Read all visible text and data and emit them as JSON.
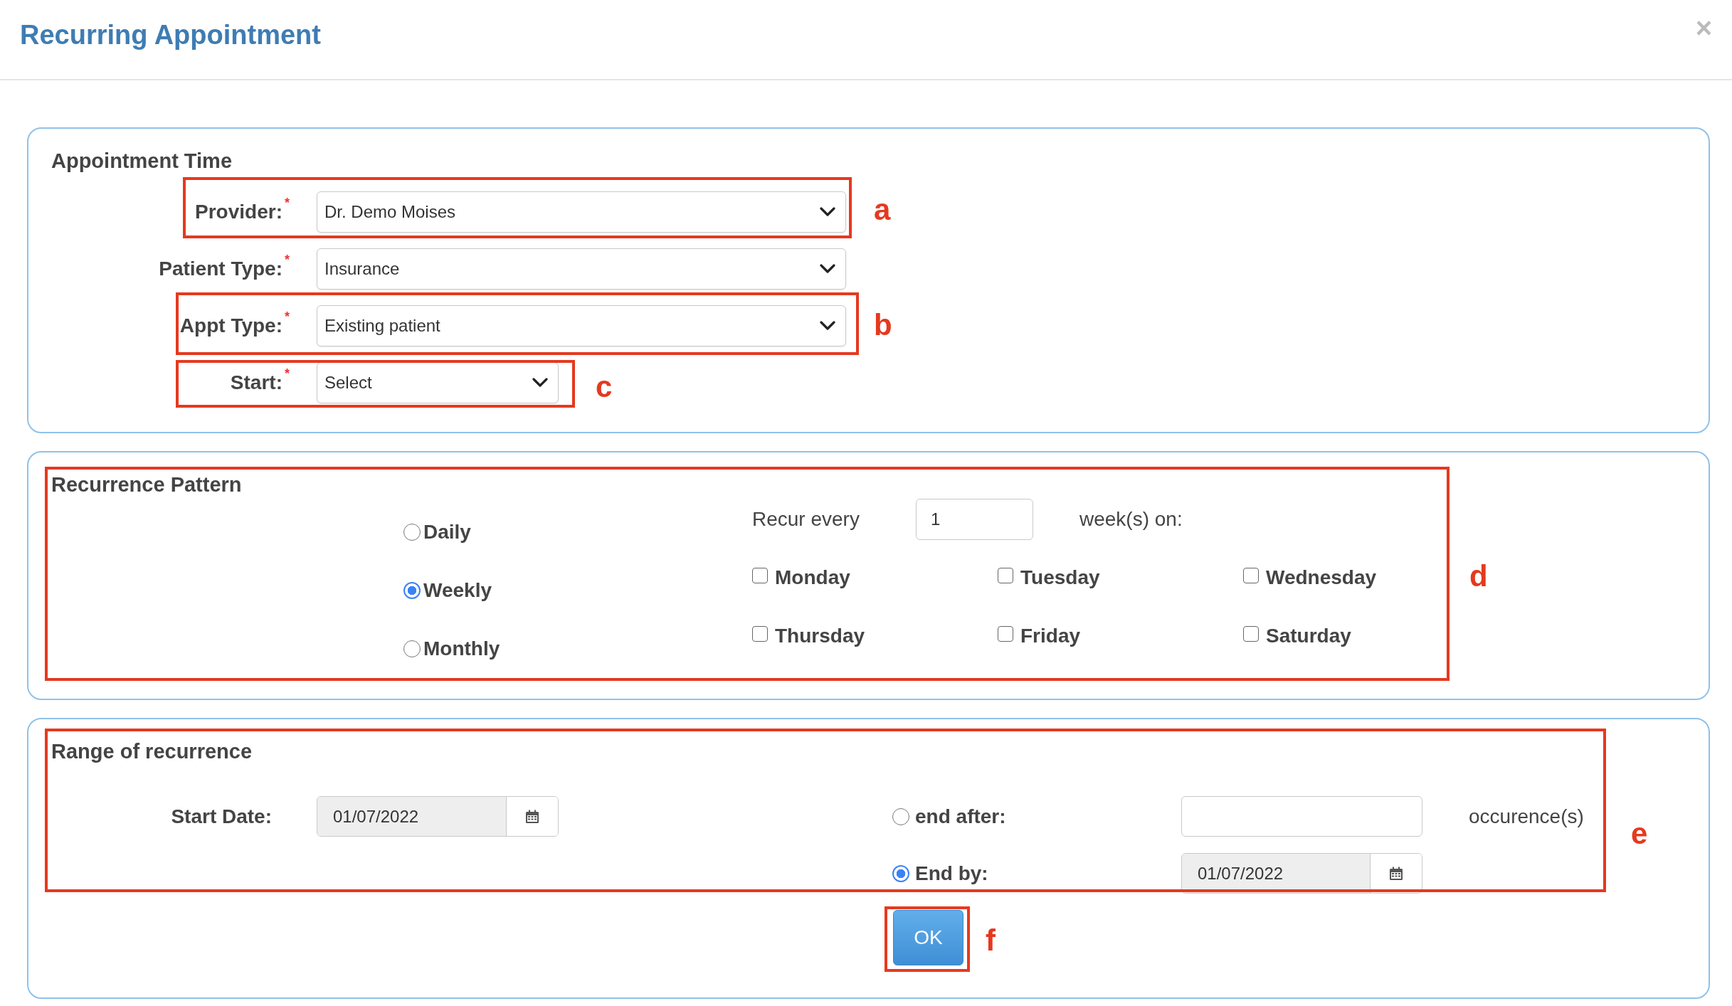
{
  "window": {
    "title": "Recurring Appointment",
    "close_label": "×"
  },
  "appointment_time": {
    "title": "Appointment Time",
    "fields": [
      {
        "label": "Provider:",
        "required_mark": "*",
        "value": "Dr. Demo Moises",
        "kind": "wide"
      },
      {
        "label": "Patient Type:",
        "required_mark": "*",
        "value": "Insurance",
        "kind": "wide"
      },
      {
        "label": "Appt Type:",
        "required_mark": "*",
        "value": "Existing patient",
        "kind": "wide"
      },
      {
        "label": "Start:",
        "required_mark": "*",
        "value": "Select",
        "kind": "narrow"
      }
    ]
  },
  "recurrence_pattern": {
    "title": "Recurrence Pattern",
    "options": [
      {
        "label": "Daily",
        "selected": false
      },
      {
        "label": "Weekly",
        "selected": true
      },
      {
        "label": "Monthly",
        "selected": false
      }
    ],
    "recur_every_label": "Recur every",
    "recur_every_value": "1",
    "recur_unit": "week(s) on:",
    "days": [
      {
        "label": "Monday",
        "checked": false
      },
      {
        "label": "Tuesday",
        "checked": false
      },
      {
        "label": "Wednesday",
        "checked": false
      },
      {
        "label": "Thursday",
        "checked": false
      },
      {
        "label": "Friday",
        "checked": false
      },
      {
        "label": "Saturday",
        "checked": false
      }
    ]
  },
  "range_of_recurrence": {
    "title": "Range of recurrence",
    "start_date_label": "Start Date:",
    "start_date": "01/07/2022",
    "end_options": [
      {
        "kind": "count",
        "label": "end after:",
        "selected": false,
        "suffix": "occurence(s)"
      },
      {
        "kind": "date",
        "label": "End by:",
        "selected": true,
        "value": "01/07/2022"
      }
    ]
  },
  "ok_button": "OK",
  "annotations": [
    {
      "label": "a"
    },
    {
      "label": "b"
    },
    {
      "label": "c"
    },
    {
      "label": "d"
    },
    {
      "label": "e"
    },
    {
      "label": "f"
    }
  ]
}
